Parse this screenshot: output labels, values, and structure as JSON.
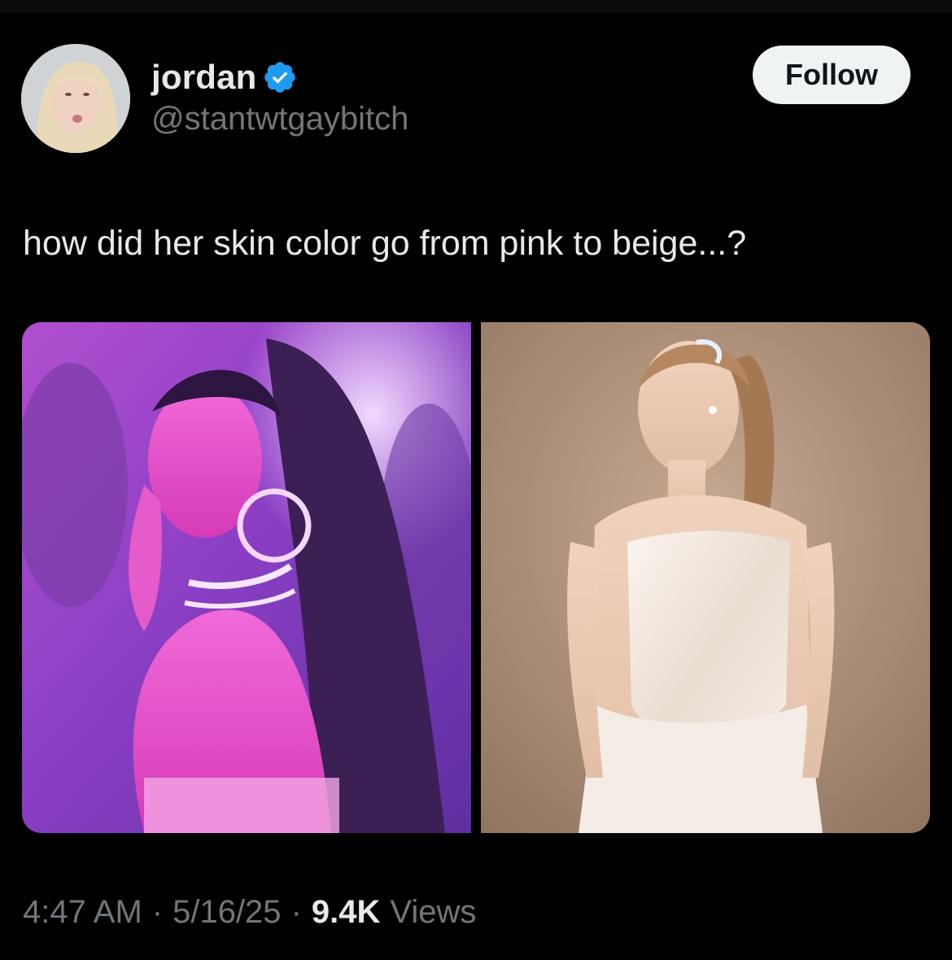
{
  "tweet": {
    "author": {
      "display_name": "jordan",
      "handle": "@stantwtgaybitch",
      "verified": true,
      "verified_color": "#1d9bf0"
    },
    "follow_label": "Follow",
    "text": "how did her skin color go from pink to beige...?",
    "media": [
      {
        "icon": "photo-pink-lighting"
      },
      {
        "icon": "photo-white-strapless-dress"
      }
    ],
    "meta": {
      "time": "4:47 AM",
      "separator": "·",
      "date": "5/16/25",
      "views_count": "9.4K",
      "views_label": "Views"
    }
  }
}
